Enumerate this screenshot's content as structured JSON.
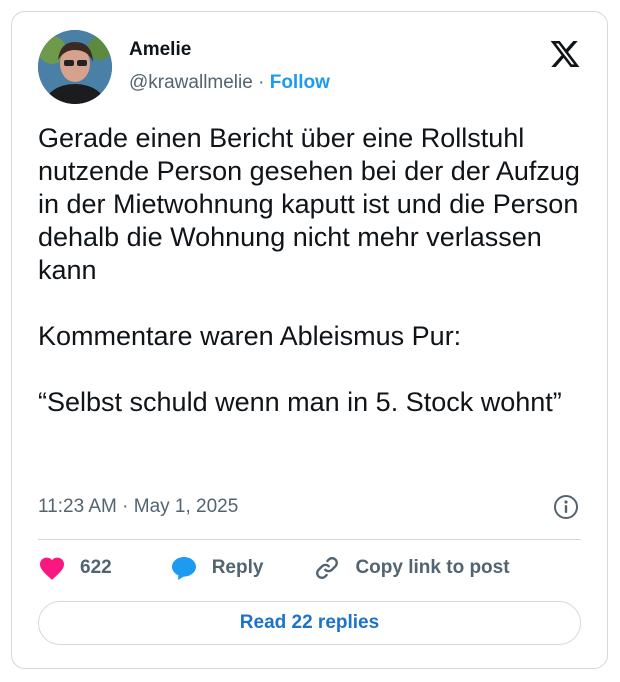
{
  "author": {
    "name": "Amelie",
    "handle": "@krawallmelie",
    "separator": "·",
    "follow_label": "Follow"
  },
  "post": {
    "text": "Gerade einen Bericht über eine Rollstuhl nutzende Person gesehen bei der der Aufzug in der Mietwohnung kaputt ist und die Person dehalb die Wohnung nicht mehr verlassen kann\n\nKommentare waren Ableismus Pur:\n\n“Selbst schuld wenn man in 5. Stock wohnt”",
    "timestamp": "11:23 AM · May 1, 2025"
  },
  "actions": {
    "like_count": "622",
    "reply_label": "Reply",
    "copy_link_label": "Copy link to post"
  },
  "read_replies_label": "Read 22 replies",
  "colors": {
    "accent": "#1d9bf0",
    "like": "#f91880",
    "reply": "#1d9bf0",
    "border": "#cfd9de",
    "secondary_text": "#536471"
  },
  "icons": [
    "avatar",
    "x-logo-icon",
    "info-icon",
    "heart-icon",
    "reply-bubble-icon",
    "link-icon"
  ]
}
